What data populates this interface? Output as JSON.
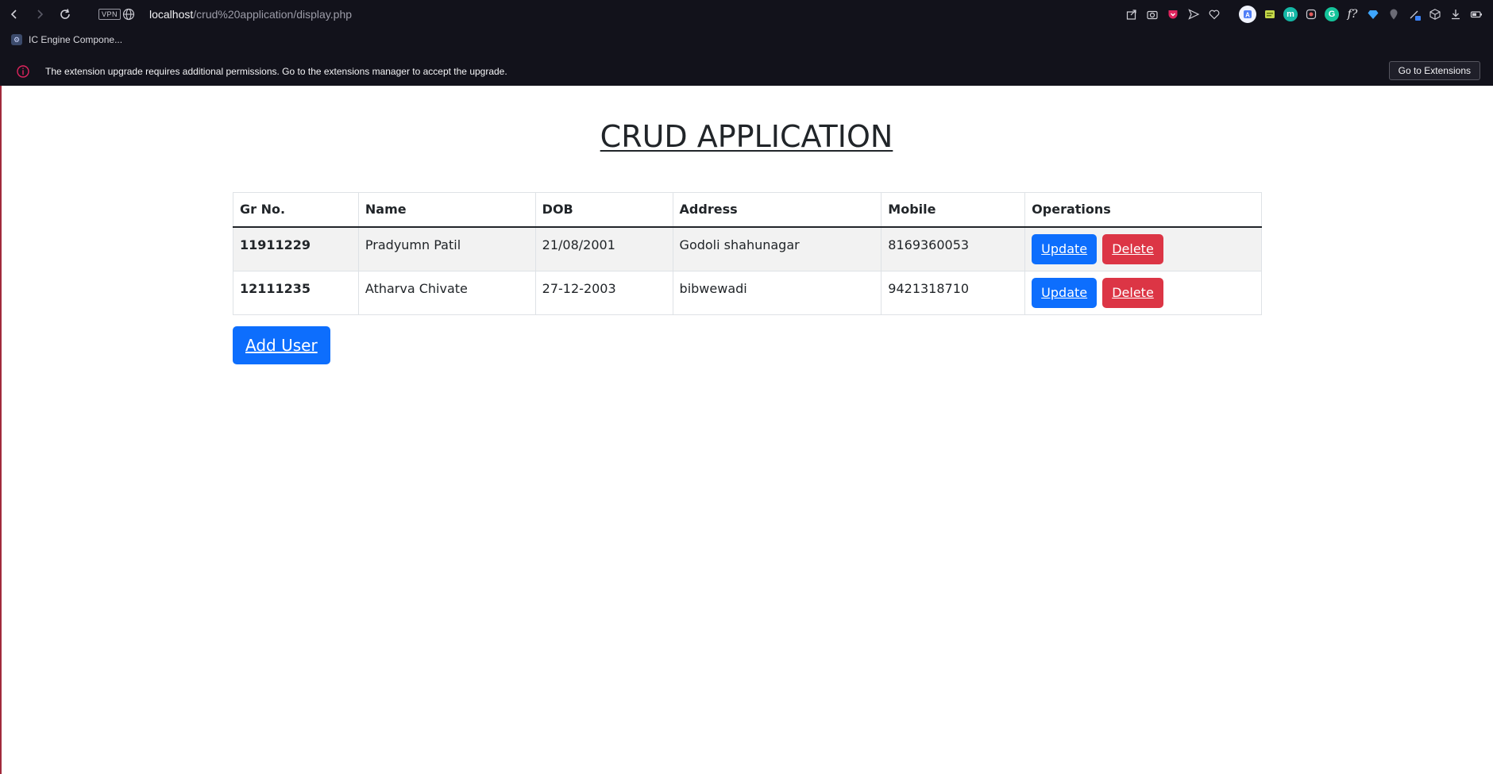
{
  "browser": {
    "url_host": "localhost",
    "url_path": "/crud%20application/display.php",
    "vpn_label": "VPN",
    "bookmarks": [
      {
        "label": "IC Engine Compone..."
      }
    ],
    "infobar": {
      "message": "The extension upgrade requires additional permissions. Go to the extensions manager to accept the upgrade.",
      "button_label": "Go to Extensions"
    },
    "extension_icons": [
      "share-icon",
      "camera-icon",
      "pocket-icon",
      "send-icon",
      "heart-icon",
      "translate-icon",
      "notes-icon",
      "m-extension-icon",
      "security-extension-icon",
      "grammarly-icon",
      "font-identifier-icon",
      "diamond-icon",
      "pin-icon",
      "pen-icon",
      "cube-icon",
      "download-icon",
      "battery-icon"
    ],
    "font_ext_label": "f?",
    "m_ext_label": "m",
    "g_ext_label": "G"
  },
  "page": {
    "title": "CRUD APPLICATION",
    "add_user_label": "Add User"
  },
  "table": {
    "headers": [
      "Gr No.",
      "Name",
      "DOB",
      "Address",
      "Mobile",
      "Operations"
    ],
    "rows": [
      {
        "gr_no": "11911229",
        "name": "Pradyumn Patil",
        "dob": "21/08/2001",
        "address": "Godoli shahunagar",
        "mobile": "8169360053",
        "update_label": "Update",
        "delete_label": "Delete"
      },
      {
        "gr_no": "12111235",
        "name": "Atharva Chivate",
        "dob": "27-12-2003",
        "address": "bibwewadi",
        "mobile": "9421318710",
        "update_label": "Update",
        "delete_label": "Delete"
      }
    ]
  },
  "colors": {
    "primary": "#0d6efd",
    "danger": "#dc3545",
    "chrome_bg": "#12121b",
    "striped_row": "#f2f2f2"
  }
}
